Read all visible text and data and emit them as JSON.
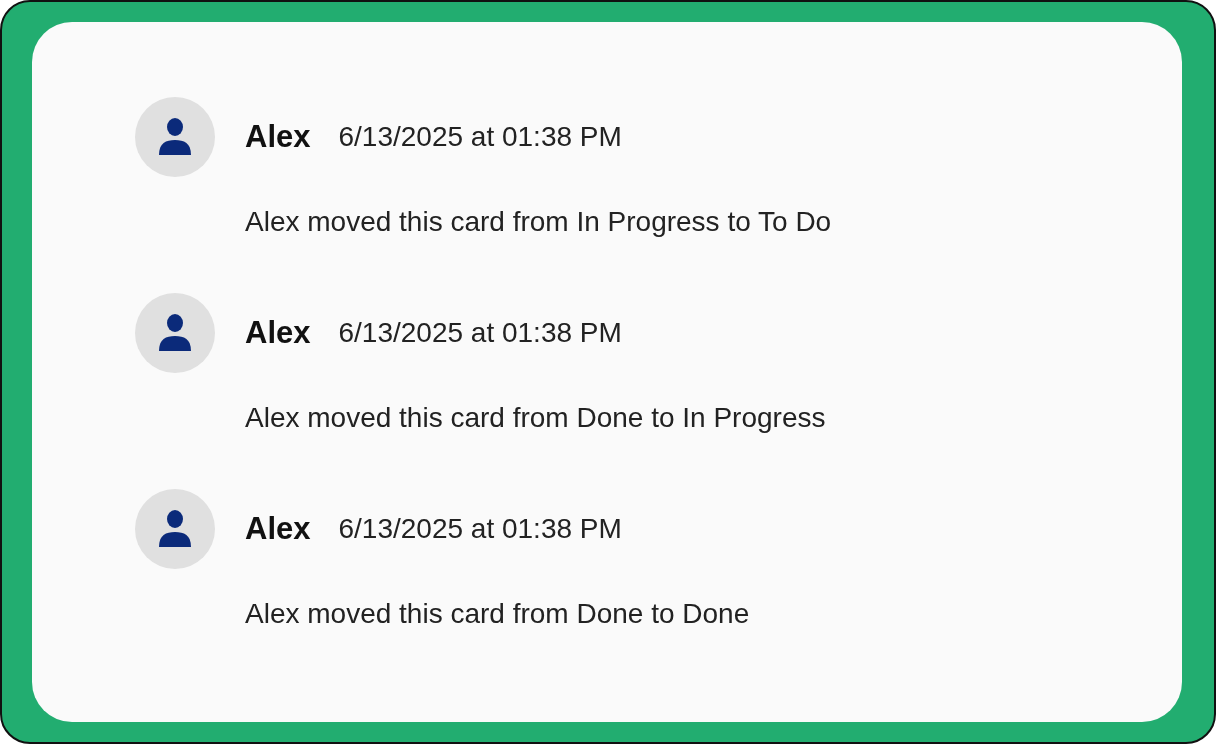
{
  "activity": [
    {
      "author": "Alex",
      "timestamp": "6/13/2025 at 01:38 PM",
      "message": "Alex moved this card from In Progress to To Do"
    },
    {
      "author": "Alex",
      "timestamp": "6/13/2025 at 01:38 PM",
      "message": "Alex moved this card from Done to In Progress"
    },
    {
      "author": "Alex",
      "timestamp": "6/13/2025 at 01:38 PM",
      "message": "Alex moved this card from Done to Done"
    }
  ]
}
